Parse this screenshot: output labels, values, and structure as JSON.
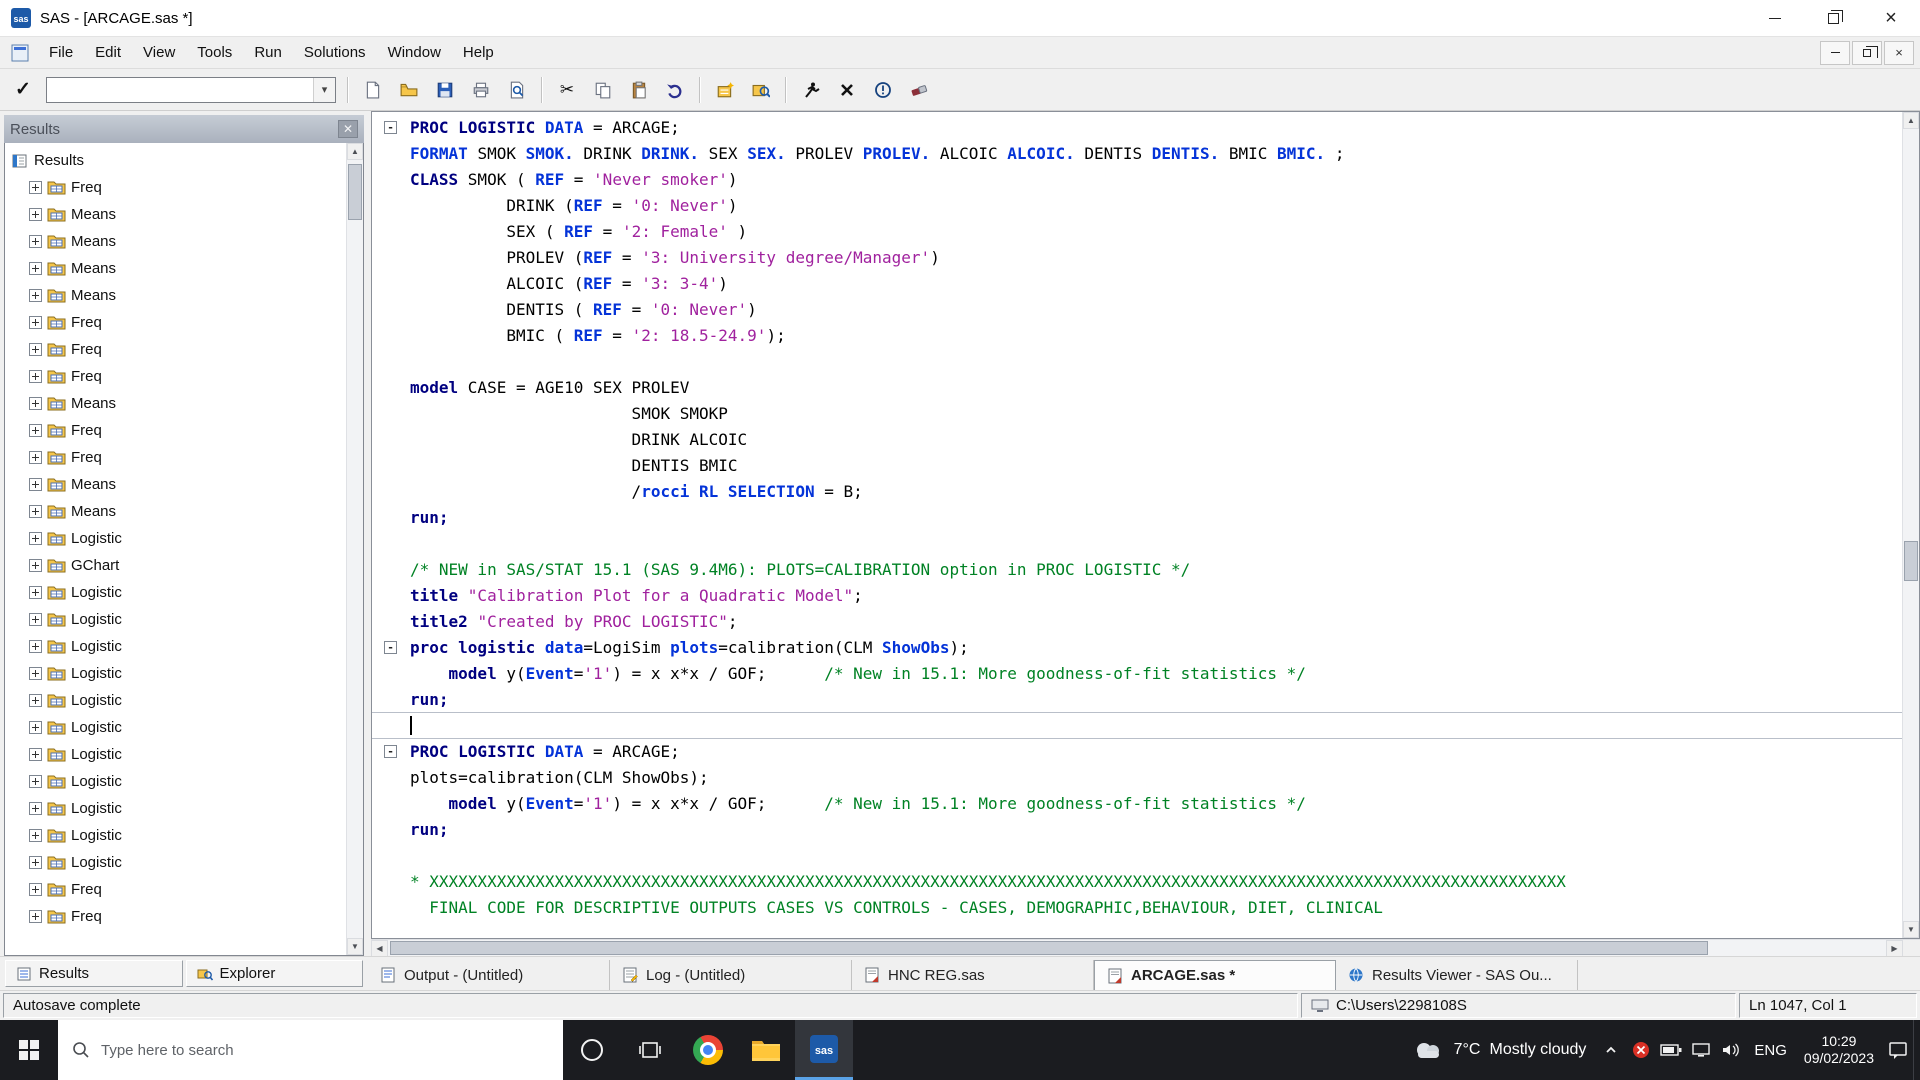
{
  "window": {
    "title": "SAS - [ARCAGE.sas *]",
    "menu": [
      "File",
      "Edit",
      "View",
      "Tools",
      "Run",
      "Solutions",
      "Window",
      "Help"
    ]
  },
  "toolbar": {
    "command_value": ""
  },
  "results_panel": {
    "title": "Results",
    "root": "Results",
    "items": [
      "Freq",
      "Means",
      "Means",
      "Means",
      "Means",
      "Freq",
      "Freq",
      "Freq",
      "Means",
      "Freq",
      "Freq",
      "Means",
      "Means",
      "Logistic",
      "GChart",
      "Logistic",
      "Logistic",
      "Logistic",
      "Logistic",
      "Logistic",
      "Logistic",
      "Logistic",
      "Logistic",
      "Logistic",
      "Logistic",
      "Logistic",
      "Freq",
      "Freq"
    ],
    "tabs": [
      "Results",
      "Explorer"
    ]
  },
  "editor": {
    "lines": [
      {
        "m": 1,
        "s": [
          [
            "kw",
            "PROC LOGISTIC "
          ],
          [
            "k2",
            "DATA"
          ],
          [
            "t",
            " = ARCAGE;"
          ]
        ]
      },
      {
        "s": [
          [
            "k2",
            "FORMAT "
          ],
          [
            "t",
            "SMOK "
          ],
          [
            "k2",
            "SMOK."
          ],
          [
            "t",
            " DRINK "
          ],
          [
            "k2",
            "DRINK."
          ],
          [
            "t",
            " SEX "
          ],
          [
            "k2",
            "SEX."
          ],
          [
            "t",
            " PROLEV "
          ],
          [
            "k2",
            "PROLEV."
          ],
          [
            "t",
            " ALCOIC "
          ],
          [
            "k2",
            "ALCOIC."
          ],
          [
            "t",
            " DENTIS "
          ],
          [
            "k2",
            "DENTIS."
          ],
          [
            "t",
            " BMIC "
          ],
          [
            "k2",
            "BMIC."
          ],
          [
            "t",
            " ;"
          ]
        ]
      },
      {
        "s": [
          [
            "kw",
            "CLASS "
          ],
          [
            "t",
            "SMOK ( "
          ],
          [
            "k2",
            "REF"
          ],
          [
            "t",
            " = "
          ],
          [
            "str",
            "'Never smoker'"
          ],
          [
            "t",
            ")"
          ]
        ]
      },
      {
        "s": [
          [
            "t",
            "          DRINK ("
          ],
          [
            "k2",
            "REF"
          ],
          [
            "t",
            " = "
          ],
          [
            "str",
            "'0: Never'"
          ],
          [
            "t",
            ")"
          ]
        ]
      },
      {
        "s": [
          [
            "t",
            "          SEX ( "
          ],
          [
            "k2",
            "REF"
          ],
          [
            "t",
            " = "
          ],
          [
            "str",
            "'2: Female'"
          ],
          [
            "t",
            " )"
          ]
        ]
      },
      {
        "s": [
          [
            "t",
            "          PROLEV ("
          ],
          [
            "k2",
            "REF"
          ],
          [
            "t",
            " = "
          ],
          [
            "str",
            "'3: University degree/Manager'"
          ],
          [
            "t",
            ")"
          ]
        ]
      },
      {
        "s": [
          [
            "t",
            "          ALCOIC ("
          ],
          [
            "k2",
            "REF"
          ],
          [
            "t",
            " = "
          ],
          [
            "str",
            "'3: 3-4'"
          ],
          [
            "t",
            ")"
          ]
        ]
      },
      {
        "s": [
          [
            "t",
            "          DENTIS ( "
          ],
          [
            "k2",
            "REF"
          ],
          [
            "t",
            " = "
          ],
          [
            "str",
            "'0: Never'"
          ],
          [
            "t",
            ")"
          ]
        ]
      },
      {
        "s": [
          [
            "t",
            "          BMIC ( "
          ],
          [
            "k2",
            "REF"
          ],
          [
            "t",
            " = "
          ],
          [
            "str",
            "'2: 18.5-24.9'"
          ],
          [
            "t",
            ");"
          ]
        ]
      },
      {
        "s": []
      },
      {
        "s": [
          [
            "kw",
            "model "
          ],
          [
            "t",
            "CASE = AGE10 SEX PROLEV"
          ]
        ]
      },
      {
        "s": [
          [
            "t",
            "                       SMOK SMOKP"
          ]
        ]
      },
      {
        "s": [
          [
            "t",
            "                       DRINK ALCOIC"
          ]
        ]
      },
      {
        "s": [
          [
            "t",
            "                       DENTIS BMIC"
          ]
        ]
      },
      {
        "s": [
          [
            "t",
            "                       /"
          ],
          [
            "k2",
            "rocci RL SELECTION"
          ],
          [
            "t",
            " = B;"
          ]
        ]
      },
      {
        "s": [
          [
            "kw",
            "run;"
          ]
        ]
      },
      {
        "s": []
      },
      {
        "s": [
          [
            "com",
            "/* NEW in SAS/STAT 15.1 (SAS 9.4M6): PLOTS=CALIBRATION option in PROC LOGISTIC */"
          ]
        ]
      },
      {
        "s": [
          [
            "kw",
            "title "
          ],
          [
            "str",
            "\"Calibration Plot for a Quadratic Model\""
          ],
          [
            "t",
            ";"
          ]
        ]
      },
      {
        "s": [
          [
            "kw",
            "title2 "
          ],
          [
            "str",
            "\"Created by PROC LOGISTIC\""
          ],
          [
            "t",
            ";"
          ]
        ]
      },
      {
        "m": 1,
        "s": [
          [
            "kw",
            "proc logistic "
          ],
          [
            "k2",
            "data"
          ],
          [
            "t",
            "=LogiSim "
          ],
          [
            "k2",
            "plots"
          ],
          [
            "t",
            "=calibration(CLM "
          ],
          [
            "k2",
            "ShowObs"
          ],
          [
            "t",
            ");"
          ]
        ]
      },
      {
        "s": [
          [
            "kw",
            "    model "
          ],
          [
            "t",
            "y("
          ],
          [
            "k2",
            "Event"
          ],
          [
            "t",
            "="
          ],
          [
            "str",
            "'1'"
          ],
          [
            "t",
            ") = x x*x / GOF;      "
          ],
          [
            "com",
            "/* New in 15.1: More goodness-of-fit statistics */"
          ]
        ]
      },
      {
        "b": 1,
        "s": [
          [
            "kw",
            "run;"
          ]
        ]
      },
      {
        "b": 1,
        "c": 1,
        "s": []
      },
      {
        "m": 1,
        "s": [
          [
            "kw",
            "PROC LOGISTIC "
          ],
          [
            "k2",
            "DATA"
          ],
          [
            "t",
            " = ARCAGE;"
          ]
        ]
      },
      {
        "s": [
          [
            "t",
            "plots=calibration(CLM ShowObs);"
          ]
        ]
      },
      {
        "s": [
          [
            "kw",
            "    model "
          ],
          [
            "t",
            "y("
          ],
          [
            "k2",
            "Event"
          ],
          [
            "t",
            "="
          ],
          [
            "str",
            "'1'"
          ],
          [
            "t",
            ") = x x*x / GOF;      "
          ],
          [
            "com",
            "/* New in 15.1: More goodness-of-fit statistics */"
          ]
        ]
      },
      {
        "s": [
          [
            "kw",
            "run;"
          ]
        ]
      },
      {
        "s": []
      },
      {
        "s": [
          [
            "com",
            "* XXXXXXXXXXXXXXXXXXXXXXXXXXXXXXXXXXXXXXXXXXXXXXXXXXXXXXXXXXXXXXXXXXXXXXXXXXXXXXXXXXXXXXXXXXXXXXXXXXXXXXXXXXXXXXXXXXXXXX"
          ]
        ]
      },
      {
        "s": [
          [
            "com",
            "  FINAL CODE FOR DESCRIPTIVE OUTPUTS CASES VS CONTROLS - CASES, DEMOGRAPHIC,BEHAVIOUR, DIET, CLINICAL"
          ]
        ]
      }
    ]
  },
  "window_tabs": [
    {
      "label": "Output - (Untitled)"
    },
    {
      "label": "Log - (Untitled)"
    },
    {
      "label": "HNC REG.sas"
    },
    {
      "label": "ARCAGE.sas *",
      "active": true
    },
    {
      "label": "Results Viewer - SAS Ou..."
    }
  ],
  "status_bar": {
    "message": "Autosave complete",
    "path": "C:\\Users\\2298108S",
    "caret_position": "Ln 1047, Col 1"
  },
  "taskbar": {
    "search_placeholder": "Type here to search",
    "weather_temp": "7°C",
    "weather_condition": "Mostly cloudy",
    "language": "ENG",
    "time": "10:29",
    "date": "09/02/2023"
  }
}
